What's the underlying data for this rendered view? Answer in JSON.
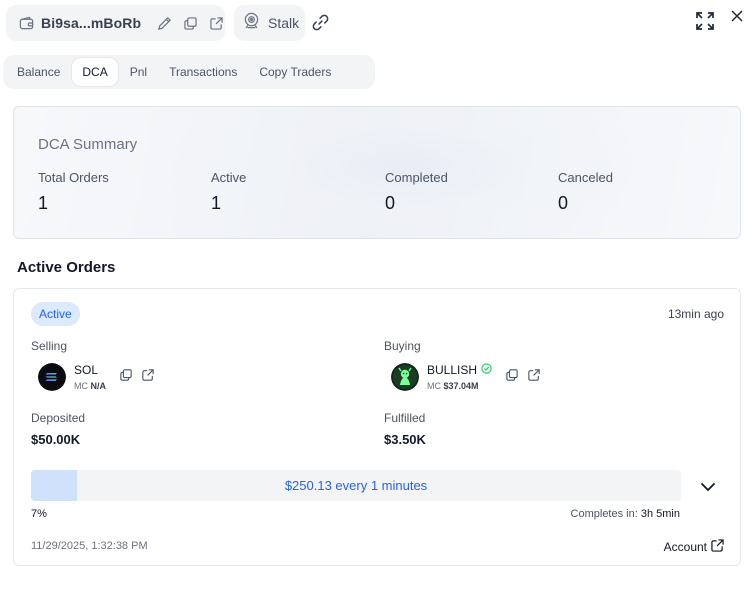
{
  "header": {
    "wallet_address": "Bi9sa...mBoRb",
    "stalk_label": "Stalk",
    "icons": [
      "wallet-icon",
      "edit-icon",
      "copy-icon",
      "external-link-icon",
      "stalk-icon",
      "link-icon",
      "expand-icon",
      "close-icon"
    ]
  },
  "tabs": [
    {
      "label": "Balance",
      "active": false
    },
    {
      "label": "DCA",
      "active": true
    },
    {
      "label": "Pnl",
      "active": false
    },
    {
      "label": "Transactions",
      "active": false
    },
    {
      "label": "Copy Traders",
      "active": false
    }
  ],
  "summary": {
    "title": "DCA Summary",
    "stats": [
      {
        "label": "Total Orders",
        "value": "1"
      },
      {
        "label": "Active",
        "value": "1"
      },
      {
        "label": "Completed",
        "value": "0"
      },
      {
        "label": "Canceled",
        "value": "0"
      }
    ]
  },
  "active_orders": {
    "title": "Active Orders",
    "order": {
      "status": "Active",
      "time_ago": "13min ago",
      "selling": {
        "label": "Selling",
        "symbol": "SOL",
        "mc_label": "MC",
        "mc_value": "N/A"
      },
      "buying": {
        "label": "Buying",
        "symbol": "BULLISH",
        "mc_label": "MC",
        "mc_value": "$37.04M"
      },
      "deposited": {
        "label": "Deposited",
        "value": "$50.00K"
      },
      "fulfilled": {
        "label": "Fulfilled",
        "value": "$3.50K"
      },
      "schedule": "$250.13 every 1 minutes",
      "progress_percent": 7,
      "progress_label": "7%",
      "completes_label": "Completes in:",
      "completes_value": "3h 5min",
      "timestamp": "11/29/2025, 1:32:38 PM",
      "account_label": "Account"
    }
  },
  "colors": {
    "accent": "#2563eb",
    "badge_bg": "#dbeafe",
    "progress_fill": "#cfe1fb",
    "verified": "#22c55e"
  }
}
